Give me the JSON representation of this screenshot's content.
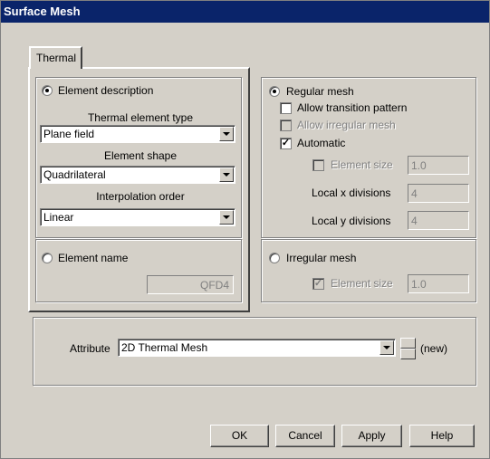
{
  "window": {
    "title": "Surface Mesh"
  },
  "tab": {
    "label": "Thermal"
  },
  "element_description": {
    "label": "Element description",
    "selected": true,
    "thermal_element_type": {
      "label": "Thermal element type",
      "value": "Plane field"
    },
    "element_shape": {
      "label": "Element shape",
      "value": "Quadrilateral"
    },
    "interpolation_order": {
      "label": "Interpolation order",
      "value": "Linear"
    }
  },
  "element_name": {
    "label": "Element name",
    "selected": false,
    "value": "QFD4"
  },
  "regular_mesh": {
    "label": "Regular mesh",
    "selected": true,
    "allow_transition_pattern": {
      "label": "Allow transition pattern",
      "checked": false
    },
    "allow_irregular_mesh": {
      "label": "Allow irregular mesh",
      "checked": false
    },
    "automatic": {
      "label": "Automatic",
      "checked": true,
      "mark": "✓"
    },
    "element_size": {
      "label": "Element size",
      "value": "1.0",
      "checked": false
    },
    "local_x_divisions": {
      "label": "Local x divisions",
      "value": "4"
    },
    "local_y_divisions": {
      "label": "Local y divisions",
      "value": "4"
    }
  },
  "irregular_mesh": {
    "label": "Irregular mesh",
    "selected": false,
    "element_size": {
      "label": "Element size",
      "value": "1.0",
      "checked": true,
      "mark": "✓"
    }
  },
  "attribute": {
    "label": "Attribute",
    "value": "2D Thermal Mesh",
    "new_label": "(new)"
  },
  "buttons": {
    "ok": "OK",
    "cancel": "Cancel",
    "apply": "Apply",
    "help": "Help"
  },
  "colors": {
    "titlebar": "#0a246a",
    "face": "#d4d0c8"
  }
}
